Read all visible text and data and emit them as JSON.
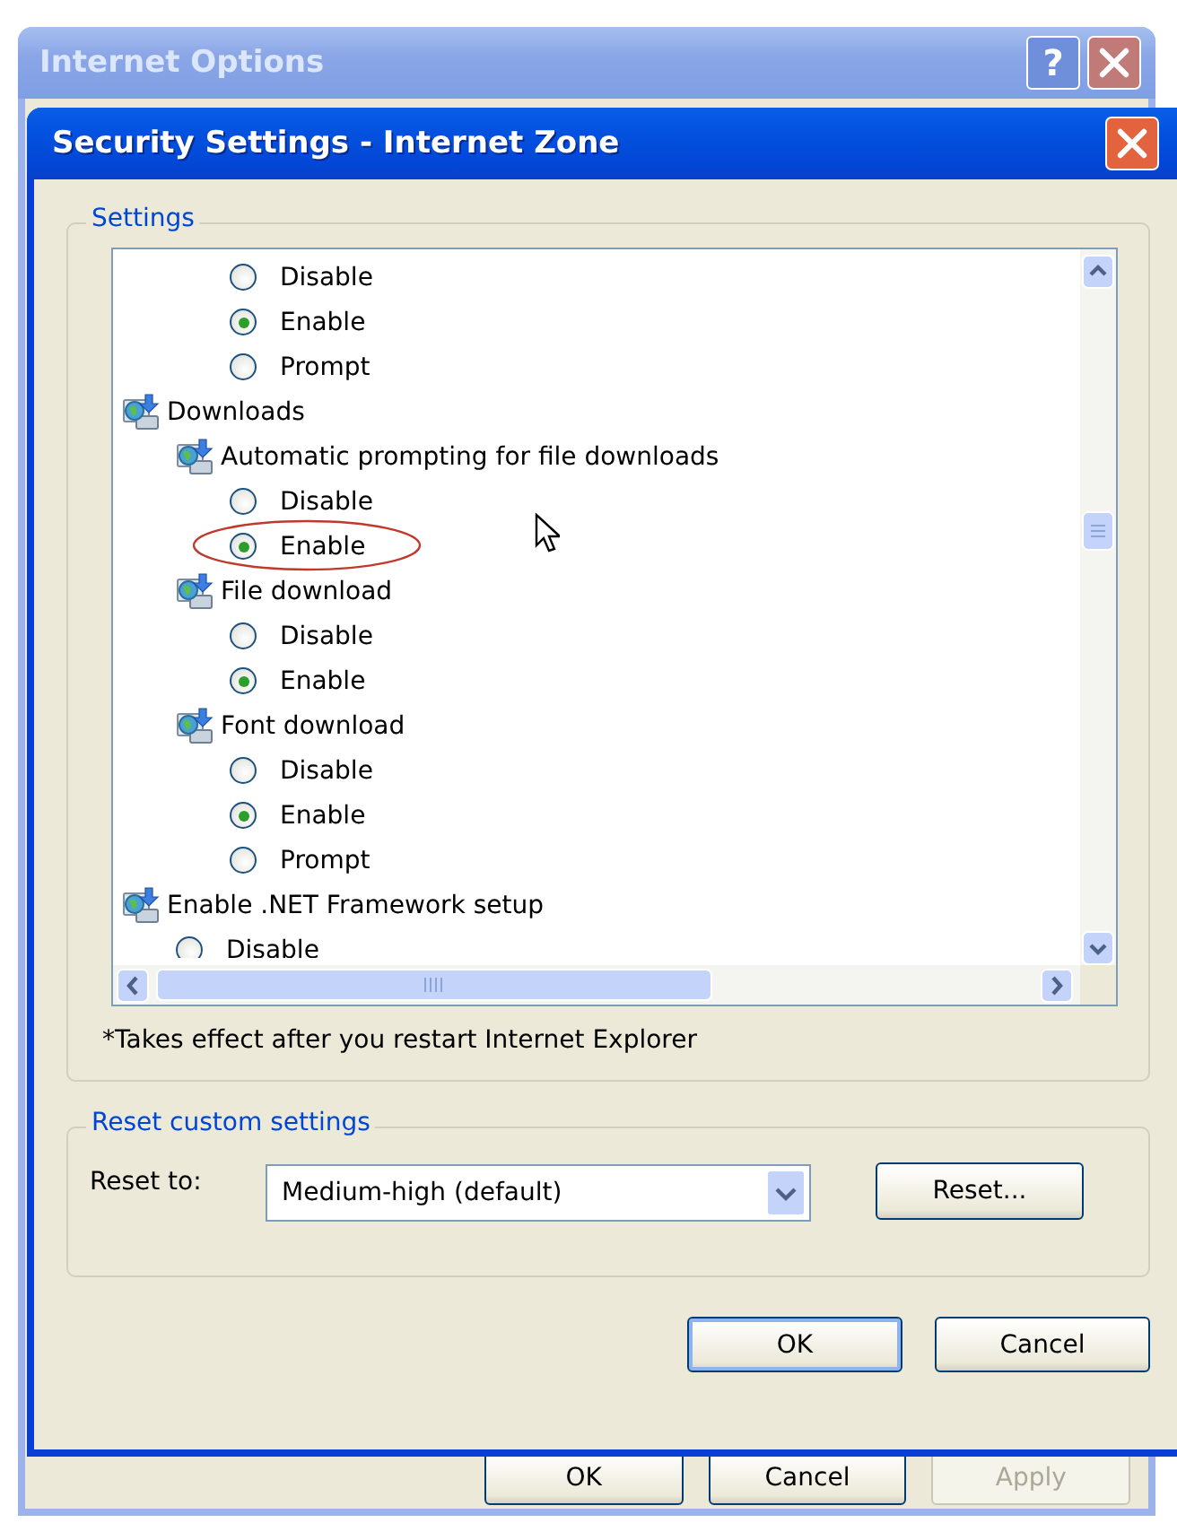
{
  "outer_window": {
    "title": "Internet Options",
    "help_button": "?",
    "buttons": [
      {
        "label": "OK",
        "disabled": false
      },
      {
        "label": "Cancel",
        "disabled": false
      },
      {
        "label": "Apply",
        "disabled": true
      }
    ]
  },
  "dialog": {
    "title": "Security Settings - Internet Zone",
    "settings": {
      "label": "Settings",
      "tree": [
        {
          "kind": "option",
          "label": "Disable",
          "selected": false,
          "circled": false
        },
        {
          "kind": "option",
          "label": "Enable",
          "selected": true,
          "circled": false
        },
        {
          "kind": "option",
          "label": "Prompt",
          "selected": false,
          "circled": false
        },
        {
          "kind": "setting",
          "label": "Downloads",
          "children": [
            {
              "kind": "setting",
              "label": "Automatic prompting for file downloads",
              "children": [
                {
                  "kind": "option",
                  "label": "Disable",
                  "selected": false,
                  "circled": false
                },
                {
                  "kind": "option",
                  "label": "Enable",
                  "selected": true,
                  "circled": true
                }
              ]
            },
            {
              "kind": "setting",
              "label": "File download",
              "children": [
                {
                  "kind": "option",
                  "label": "Disable",
                  "selected": false,
                  "circled": false
                },
                {
                  "kind": "option",
                  "label": "Enable",
                  "selected": true,
                  "circled": false
                }
              ]
            },
            {
              "kind": "setting",
              "label": "Font download",
              "children": [
                {
                  "kind": "option",
                  "label": "Disable",
                  "selected": false,
                  "circled": false
                },
                {
                  "kind": "option",
                  "label": "Enable",
                  "selected": true,
                  "circled": false
                },
                {
                  "kind": "option",
                  "label": "Prompt",
                  "selected": false,
                  "circled": false
                }
              ]
            }
          ]
        },
        {
          "kind": "setting",
          "label": "Enable .NET Framework setup",
          "children": [
            {
              "kind": "option",
              "label": "Disable",
              "selected": false,
              "circled": false
            }
          ]
        }
      ],
      "note": "*Takes effect after you restart Internet Explorer"
    },
    "reset": {
      "label": "Reset custom settings",
      "field_label": "Reset to:",
      "value": "Medium-high (default)",
      "button": "Reset..."
    },
    "buttons": [
      {
        "label": "OK",
        "default": true
      },
      {
        "label": "Cancel",
        "default": false
      }
    ]
  }
}
